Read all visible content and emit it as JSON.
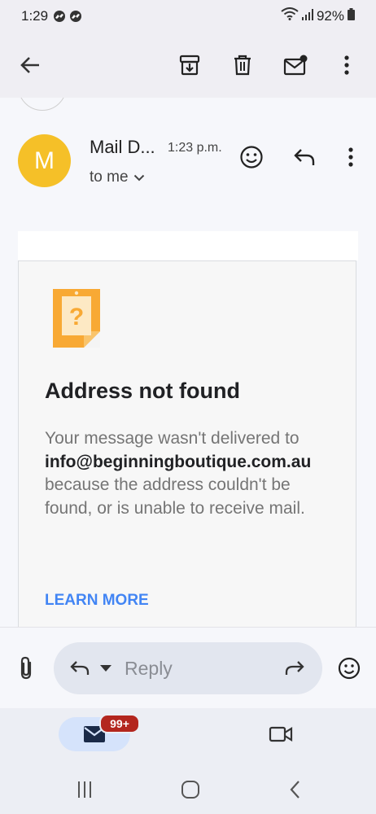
{
  "status_bar": {
    "time": "1:29",
    "battery": "92%"
  },
  "email": {
    "sender": "Mail D...",
    "time": "1:23 p.m.",
    "recipient": "to me",
    "avatar_letter": "M"
  },
  "bounce_card": {
    "title": "Address not found",
    "body_before": "Your message wasn't delivered to",
    "address": "info@beginningboutique.com.au",
    "body_after": "because the address couldn't be found, or is unable to receive mail.",
    "link_label": "LEARN MORE"
  },
  "reply_bar": {
    "placeholder": "Reply"
  },
  "bottom_nav": {
    "mail_badge": "99+"
  },
  "colors": {
    "avatar": "#f5c028",
    "link": "#4285f4",
    "badge": "#b3261e",
    "warning_icon": "#f8a934"
  },
  "icons": {
    "app_bar": [
      "back-arrow-icon",
      "archive-icon",
      "trash-icon",
      "mark-unread-icon",
      "more-vert-icon"
    ],
    "header": [
      "emoji-react-icon",
      "reply-icon",
      "more-vert-icon"
    ],
    "reply_bar": [
      "attachment-icon",
      "reply-icon",
      "dropdown-icon",
      "forward-icon",
      "emoji-icon"
    ],
    "bottom_nav": [
      "mail-icon",
      "video-icon"
    ],
    "system_nav": [
      "recents-icon",
      "home-icon",
      "back-icon"
    ]
  }
}
